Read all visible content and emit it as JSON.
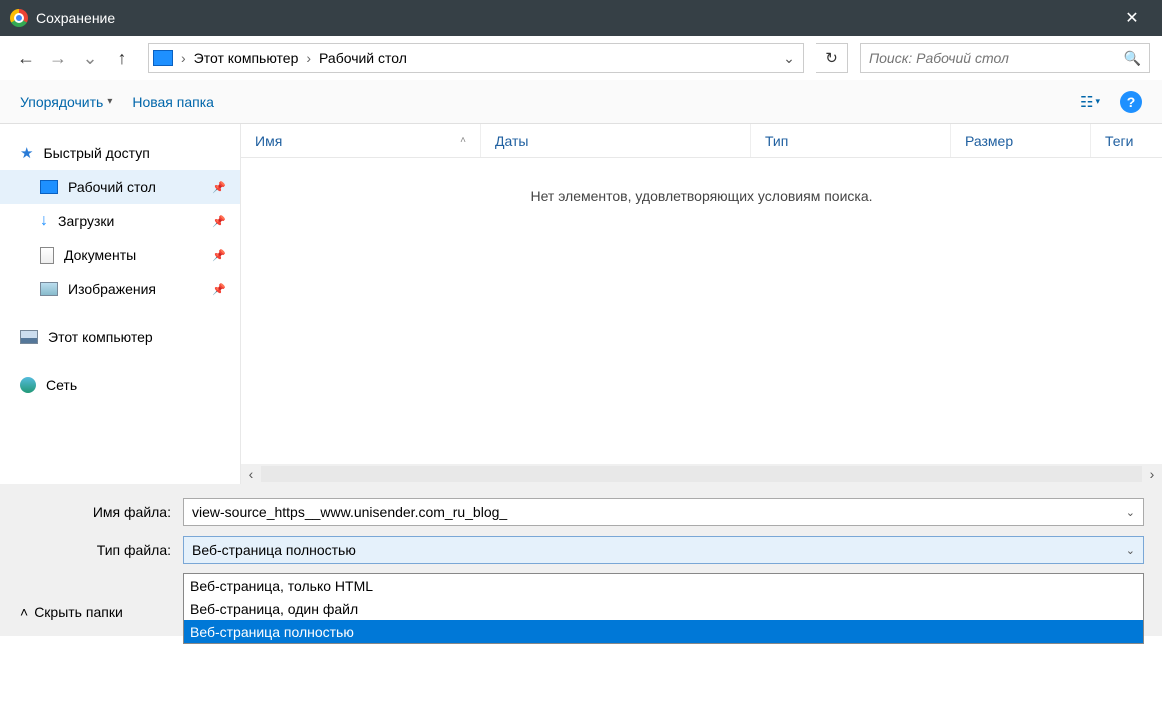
{
  "title": "Сохранение",
  "breadcrumb": {
    "item1": "Этот компьютер",
    "item2": "Рабочий стол"
  },
  "search": {
    "placeholder": "Поиск: Рабочий стол"
  },
  "toolbar": {
    "organize": "Упорядочить",
    "newfolder": "Новая папка"
  },
  "sidebar": {
    "quick": "Быстрый доступ",
    "desktop": "Рабочий стол",
    "downloads": "Загрузки",
    "documents": "Документы",
    "pictures": "Изображения",
    "thispc": "Этот компьютер",
    "network": "Сеть"
  },
  "columns": {
    "name": "Имя",
    "dates": "Даты",
    "type": "Тип",
    "size": "Размер",
    "tags": "Теги"
  },
  "empty_msg": "Нет элементов, удовлетворяющих условиям поиска.",
  "fields": {
    "filename_label": "Имя файла:",
    "filename_value": "view-source_https__www.unisender.com_ru_blog_",
    "filetype_label": "Тип файла:",
    "filetype_value": "Веб-страница полностью"
  },
  "dropdown": {
    "opt1": "Веб-страница, только HTML",
    "opt2": "Веб-страница, один файл",
    "opt3": "Веб-страница полностью"
  },
  "footer": {
    "hide": "Скрыть папки"
  }
}
